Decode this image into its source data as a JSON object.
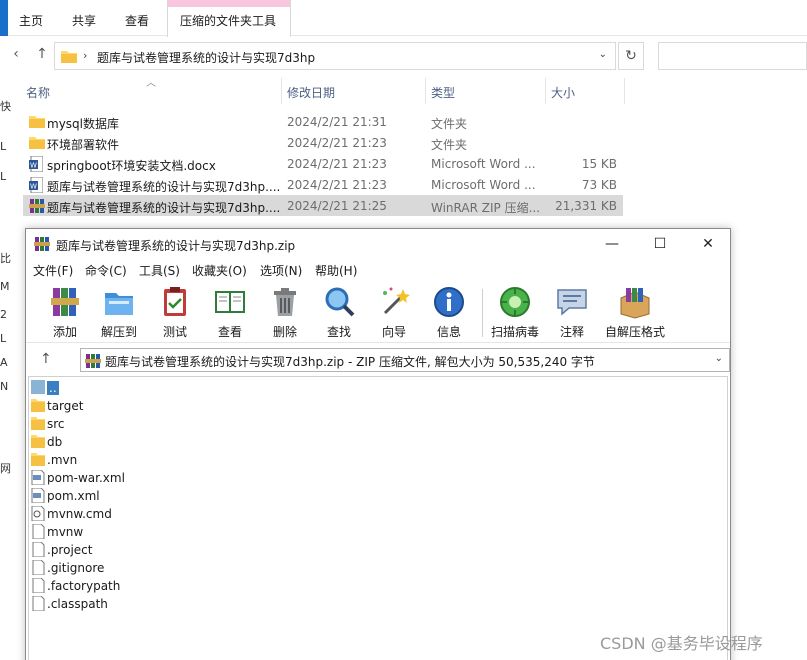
{
  "ribbon": {
    "tabs": [
      "主页",
      "共享",
      "查看"
    ],
    "context_tab": "压缩的文件夹工具",
    "context_color": "#f9c6df",
    "accent": "#1a6fc9"
  },
  "nav": {
    "back_icon": "arrow-up-icon",
    "path": "题库与试卷管理系统的设计与实现7d3hp",
    "separator": "›"
  },
  "leftpane": [
    "快",
    "L",
    "L",
    "比",
    "M",
    "2",
    "L",
    "A",
    "N",
    "网"
  ],
  "explorer": {
    "columns": [
      "名称",
      "修改日期",
      "类型",
      "大小"
    ],
    "files": [
      {
        "name": "mysql数据库",
        "date": "2024/2/21 21:31",
        "type": "文件夹",
        "size": "",
        "icon": "folder-icon",
        "selected": false
      },
      {
        "name": "环境部署软件",
        "date": "2024/2/21 21:23",
        "type": "文件夹",
        "size": "",
        "icon": "folder-icon",
        "selected": false
      },
      {
        "name": "springboot环境安装文档.docx",
        "date": "2024/2/21 21:23",
        "type": "Microsoft Word ...",
        "size": "15 KB",
        "icon": "word-icon",
        "selected": false
      },
      {
        "name": "题库与试卷管理系统的设计与实现7d3hp....",
        "date": "2024/2/21 21:23",
        "type": "Microsoft Word ...",
        "size": "73 KB",
        "icon": "word-icon",
        "selected": false
      },
      {
        "name": "题库与试卷管理系统的设计与实现7d3hp....",
        "date": "2024/2/21 21:25",
        "type": "WinRAR ZIP 压缩...",
        "size": "21,331 KB",
        "icon": "winrar-icon",
        "selected": true
      }
    ]
  },
  "rar": {
    "title": "题库与试卷管理系统的设计与实现7d3hp.zip",
    "menu": [
      "文件(F)",
      "命令(C)",
      "工具(S)",
      "收藏夹(O)",
      "选项(N)",
      "帮助(H)"
    ],
    "toolbar": [
      {
        "label": "添加",
        "icon": "add-archive-icon"
      },
      {
        "label": "解压到",
        "icon": "extract-folder-icon"
      },
      {
        "label": "测试",
        "icon": "test-clipboard-icon"
      },
      {
        "label": "查看",
        "icon": "view-book-icon"
      },
      {
        "label": "删除",
        "icon": "trash-icon"
      },
      {
        "label": "查找",
        "icon": "magnifier-icon"
      },
      {
        "label": "向导",
        "icon": "wizard-wand-icon"
      },
      {
        "label": "信息",
        "icon": "info-icon"
      },
      {
        "label": "扫描病毒",
        "icon": "virus-scan-icon"
      },
      {
        "label": "注释",
        "icon": "comment-icon"
      },
      {
        "label": "自解压格式",
        "icon": "sfx-box-icon"
      }
    ],
    "path_text": "题库与试卷管理系统的设计与实现7d3hp.zip - ZIP 压缩文件, 解包大小为 50,535,240 字节",
    "items": [
      {
        "name": "..",
        "icon": "parent-folder-icon",
        "selected": true
      },
      {
        "name": "target",
        "icon": "folder-icon",
        "selected": false
      },
      {
        "name": "src",
        "icon": "folder-icon",
        "selected": false
      },
      {
        "name": "db",
        "icon": "folder-icon",
        "selected": false
      },
      {
        "name": ".mvn",
        "icon": "folder-icon",
        "selected": false
      },
      {
        "name": "pom-war.xml",
        "icon": "xml-file-icon",
        "selected": false
      },
      {
        "name": "pom.xml",
        "icon": "xml-file-icon",
        "selected": false
      },
      {
        "name": "mvnw.cmd",
        "icon": "cmd-file-icon",
        "selected": false
      },
      {
        "name": "mvnw",
        "icon": "file-icon",
        "selected": false
      },
      {
        "name": ".project",
        "icon": "file-icon",
        "selected": false
      },
      {
        "name": ".gitignore",
        "icon": "file-icon",
        "selected": false
      },
      {
        "name": ".factorypath",
        "icon": "file-icon",
        "selected": false
      },
      {
        "name": ".classpath",
        "icon": "file-icon",
        "selected": false
      }
    ]
  },
  "watermark": "CSDN @基务毕设程序"
}
